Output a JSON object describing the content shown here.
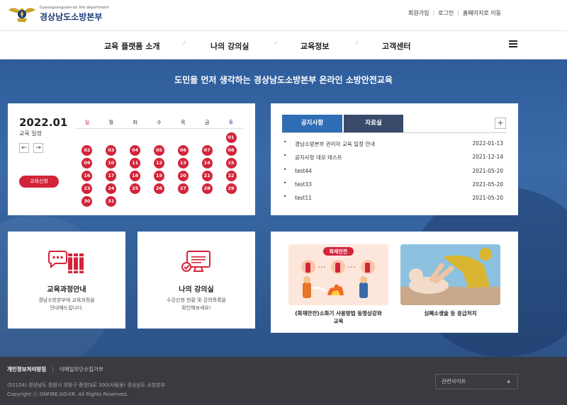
{
  "header": {
    "logo_sub": "Gyeongsangnam-do fire department",
    "logo_main": "경상남도소방본부",
    "util_links": [
      "회원가입",
      "로그인",
      "홈페이지로 이동"
    ]
  },
  "nav": {
    "items": [
      "교육 플랫폼 소개",
      "나의 강의실",
      "교육정보",
      "고객센터"
    ]
  },
  "hero": {
    "title": "도민을 먼저 생각하는 경상남도소방본부 온라인 소방안전교육"
  },
  "calendar": {
    "date": "2022.01",
    "subtitle": "교육 일정",
    "prev": "←",
    "next": "→",
    "apply_label": "교육신청",
    "weekdays": [
      "일",
      "월",
      "화",
      "수",
      "목",
      "금",
      "토"
    ],
    "days": [
      "",
      "",
      "",
      "",
      "",
      "",
      "01",
      "02",
      "03",
      "04",
      "05",
      "06",
      "07",
      "08",
      "09",
      "10",
      "11",
      "12",
      "13",
      "14",
      "15",
      "16",
      "17",
      "18",
      "19",
      "20",
      "21",
      "22",
      "23",
      "24",
      "25",
      "26",
      "27",
      "28",
      "29",
      "30",
      "31",
      "",
      "",
      "",
      "",
      ""
    ]
  },
  "board": {
    "tabs": [
      "공지사항",
      "자료실"
    ],
    "more": "+",
    "bullet": "•",
    "items": [
      {
        "title": "경남소방본부 관리자 교육 일정 안내",
        "date": "2022-01-13"
      },
      {
        "title": "공지사항 데모 테스트",
        "date": "2021-12-14"
      },
      {
        "title": "test44",
        "date": "2021-05-20"
      },
      {
        "title": "test33",
        "date": "2021-05-20"
      },
      {
        "title": "test11",
        "date": "2021-05-20"
      }
    ]
  },
  "info_cards": [
    {
      "title": "교육과정안내",
      "desc1": "경남소방본부에 교육과정을",
      "desc2": "안내해드립니다.",
      "icon": "chat-books-icon"
    },
    {
      "title": "나의 강의실",
      "desc1": "수강신청 현황 및 강의목록을",
      "desc2": "확인해보세요!",
      "icon": "monitor-check-icon"
    }
  ],
  "videos": [
    {
      "caption1": "(화재안전)소화기 사용방법 동영상강좌",
      "caption2": "교육",
      "badge": "화재안전"
    },
    {
      "caption1": "심폐소생술 등 응급처치",
      "caption2": ""
    }
  ],
  "footer": {
    "privacy": "개인정보처리방침",
    "email_policy": "이메일무단수집거부",
    "address": "(51154) 경상남도 창원시 의창구 중앙대로 300(사림동) 경상남도 소방본부",
    "copyright": "Copyright ⓒ GNFIRE.GO.KR. All Rights Reserved.",
    "related_select": "관련사이트"
  },
  "colors": {
    "accent_red": "#d3243a",
    "tab_active": "#2f6db5",
    "tab_inactive": "#3a4a6a",
    "brand_navy": "#1d3c78",
    "hero_blue": "#3a6aa8",
    "footer_bg": "#3a3b40"
  }
}
